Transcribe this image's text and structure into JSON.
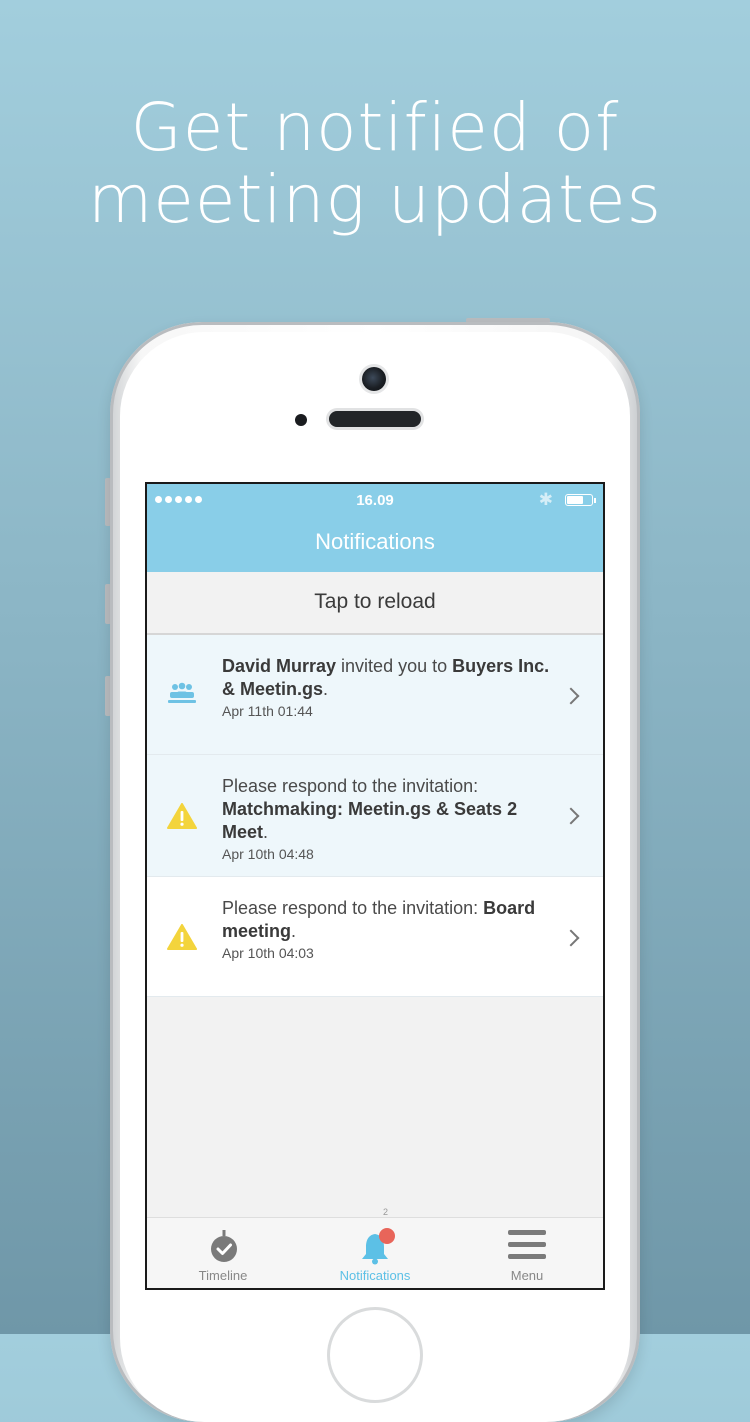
{
  "headline": {
    "line1": "Get notified of",
    "line2": "meeting updates"
  },
  "status_bar": {
    "time": "16.09",
    "bluetooth_icon": "bluetooth-icon",
    "battery_icon": "battery-icon"
  },
  "nav": {
    "title": "Notifications"
  },
  "reload": {
    "label": "Tap to reload"
  },
  "notifications": [
    {
      "icon": "people-icon",
      "parts": [
        {
          "text": "David Murray",
          "bold": true
        },
        {
          "text": " invited you to ",
          "bold": false
        },
        {
          "text": "Buyers Inc. & Meetin.gs",
          "bold": true
        },
        {
          "text": ".",
          "bold": false
        }
      ],
      "time": "Apr 11th 01:44",
      "unread": true
    },
    {
      "icon": "warning-icon",
      "parts": [
        {
          "text": "Please respond to the invitation: ",
          "bold": false
        },
        {
          "text": "Matchmaking: Meetin.gs & Seats 2 Meet",
          "bold": true
        },
        {
          "text": ".",
          "bold": false
        }
      ],
      "time": "Apr 10th 04:48",
      "unread": true
    },
    {
      "icon": "warning-icon",
      "parts": [
        {
          "text": "Please respond to the invitation: ",
          "bold": false
        },
        {
          "text": "Board meeting",
          "bold": true
        },
        {
          "text": ".",
          "bold": false
        }
      ],
      "time": "Apr 10th 04:03",
      "unread": false
    }
  ],
  "tabs": [
    {
      "label": "Timeline",
      "icon": "timeline-check-icon",
      "active": false
    },
    {
      "label": "Notifications",
      "icon": "bell-icon",
      "active": true,
      "badge": "2"
    },
    {
      "label": "Menu",
      "icon": "hamburger-menu-icon",
      "active": false
    }
  ],
  "colors": {
    "accent": "#89cee8",
    "active_tab": "#5cc0e6",
    "warning": "#f3d43c",
    "badge": "#e8655a"
  }
}
